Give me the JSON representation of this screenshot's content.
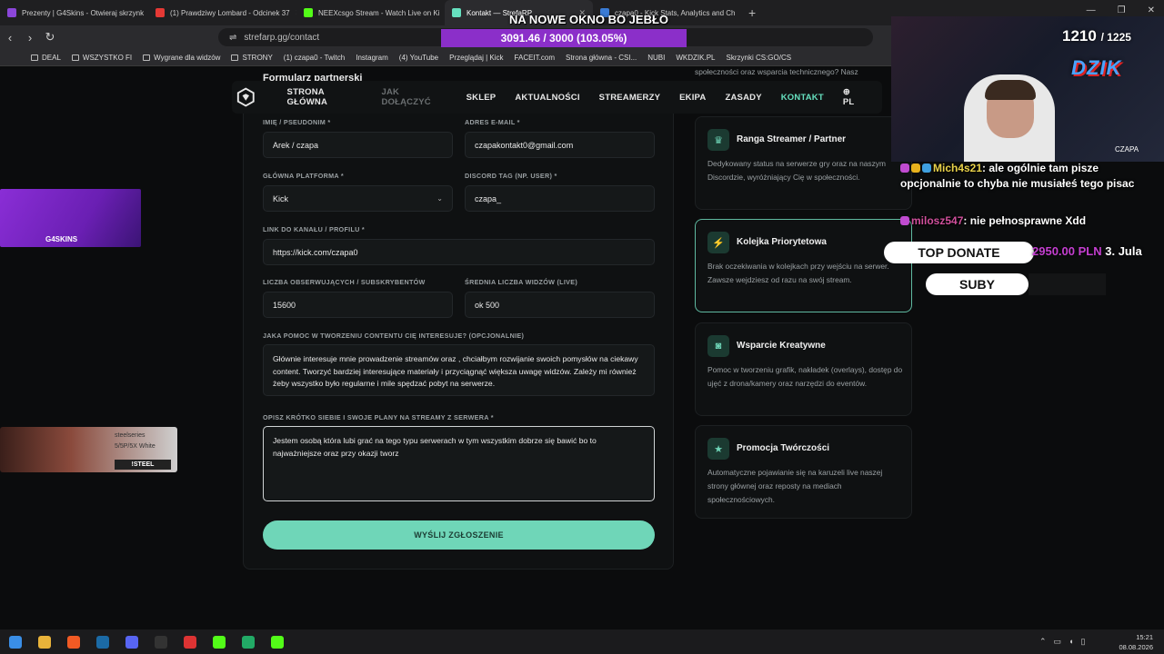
{
  "browser": {
    "tabs": [
      {
        "label": "Prezenty | G4Skins - Otwieraj skrzynk",
        "color": "#8b46d9"
      },
      {
        "label": "(1) Prawdziwy Lombard - Odcinek 37",
        "color": "#e53935"
      },
      {
        "label": "NEEXcsgo Stream - Watch Live on Ki",
        "color": "#53fc18"
      },
      {
        "label": "Kontakt — StrefaRP",
        "color": "#66e0bf"
      },
      {
        "label": "czapa0 - Kick Stats, Analytics and Ch",
        "color": "#3a7bd5"
      }
    ],
    "active_tab_index": 3,
    "url": "strefarp.gg/contact",
    "bookmarks": [
      "DEAL",
      "WSZYSTKO FI",
      "Wygrane dla widzów",
      "STRONY",
      "(1) czapa0 - Twitch",
      "Instagram",
      "(4) YouTube",
      "Przeglądaj | Kick",
      "FACEIT.com",
      "Strona główna - CSI...",
      "NUBI",
      "WKDZIK.PL",
      "Skrzynki CS:GO/CS"
    ]
  },
  "site": {
    "nav": [
      "STRONA GŁÓWNA",
      "JAK DOŁĄCZYĆ",
      "SKLEP",
      "AKTUALNOŚCI",
      "STREAMERZY",
      "EKIPA",
      "ZASADY",
      "KONTAKT"
    ],
    "lang": "PL",
    "partial_heading": "Formularz partnerski",
    "partial_right_text": "społeczności oraz wsparcia technicznego? Nasz"
  },
  "form": {
    "name_label": "IMIĘ / PSEUDONIM *",
    "name_value": "Arek / czapa",
    "email_label": "ADRES E-MAIL *",
    "email_value": "czapakontakt0@gmail.com",
    "platform_label": "GŁÓWNA PLATFORMA *",
    "platform_value": "Kick",
    "discord_label": "DISCORD TAG (NP. USER) *",
    "discord_value": "czapa_",
    "link_label": "LINK DO KANAŁU / PROFILU *",
    "link_value": "https://kick.com/czapa0",
    "followers_label": "LICZBA OBSERWUJĄCYCH / SUBSKRYBENTÓW",
    "followers_value": "15600",
    "viewers_label": "ŚREDNIA LICZBA WIDZÓW (LIVE)",
    "viewers_value": "ok 500",
    "help_label": "JAKA POMOC W TWORZENIU CONTENTU CIĘ INTERESUJE? (OPCJONALNIE)",
    "help_value": "Głównie interesuje mnie  prowadzenie streamów oraz , chciałbym rozwijanie swoich pomysłów na ciekawy content. Tworzyć bardziej interesujące materiały i przyciągnąć większa uwagę widzów. Zależy mi również żeby wszystko  było regularne i mile spędzać pobyt na serwerze.",
    "plans_label": "OPISZ KRÓTKO SIEBIE I SWOJE PLANY NA STREAMY Z SERWERA *",
    "plans_value": "Jestem osobą która lubi grać na tego typu serwerach w tym wszystkim dobrze się bawić bo to najważniejsze oraz przy okazji tworz",
    "submit_label": "WYŚLIJ ZGŁOSZENIE"
  },
  "benefits": [
    {
      "title": "Ranga Streamer / Partner",
      "desc": "Dedykowany status na serwerze gry oraz na naszym Discordzie, wyróżniający Cię w społeczności.",
      "icon": "trophy-icon"
    },
    {
      "title": "Kolejka Priorytetowa",
      "desc": "Brak oczekiwania w kolejkach przy wejściu na serwer. Zawsze wejdziesz od razu na swój stream.",
      "icon": "lightning-icon"
    },
    {
      "title": "Wsparcie Kreatywne",
      "desc": "Pomoc w tworzeniu grafik, nakładek (overlays), dostęp do ujęć z drona/kamery oraz narzędzi do eventów.",
      "icon": "camera-icon"
    },
    {
      "title": "Promocja Twórczości",
      "desc": "Automatyczne pojawianie się na karuzeli live naszej strony głównej oraz reposty na mediach społecznościowych.",
      "icon": "star-icon"
    }
  ],
  "overlay": {
    "alert": "NA NOWE OKNO BO JEBŁO",
    "viewer_goal": "3091.46 / 3000 (103.05%)",
    "counter_current": "1210",
    "counter_total": "/ 1225",
    "brand": "DZIK",
    "cam_name": "CZAPA",
    "chat": [
      {
        "user": "Mich4s21",
        "msg": ": ale ogólnie tam pisze opcjonalnie to chyba nie musiałeś tego pisac"
      },
      {
        "user": "milosz547",
        "msg": ": nie pełnosprawne Xdd"
      }
    ],
    "top_donate_label": "TOP DONATE",
    "top_donate_value": "2950.00 PLN",
    "top_donate_name": "3. Jula",
    "subs_label": "SUBY",
    "g4_label": "G4SKINS",
    "ss_brand": "steelseries",
    "ss_model": "5/5P/5X White",
    "ss_code": "!STEEL"
  },
  "taskbar": {
    "time": "15:21",
    "date": "08.08.2026"
  }
}
